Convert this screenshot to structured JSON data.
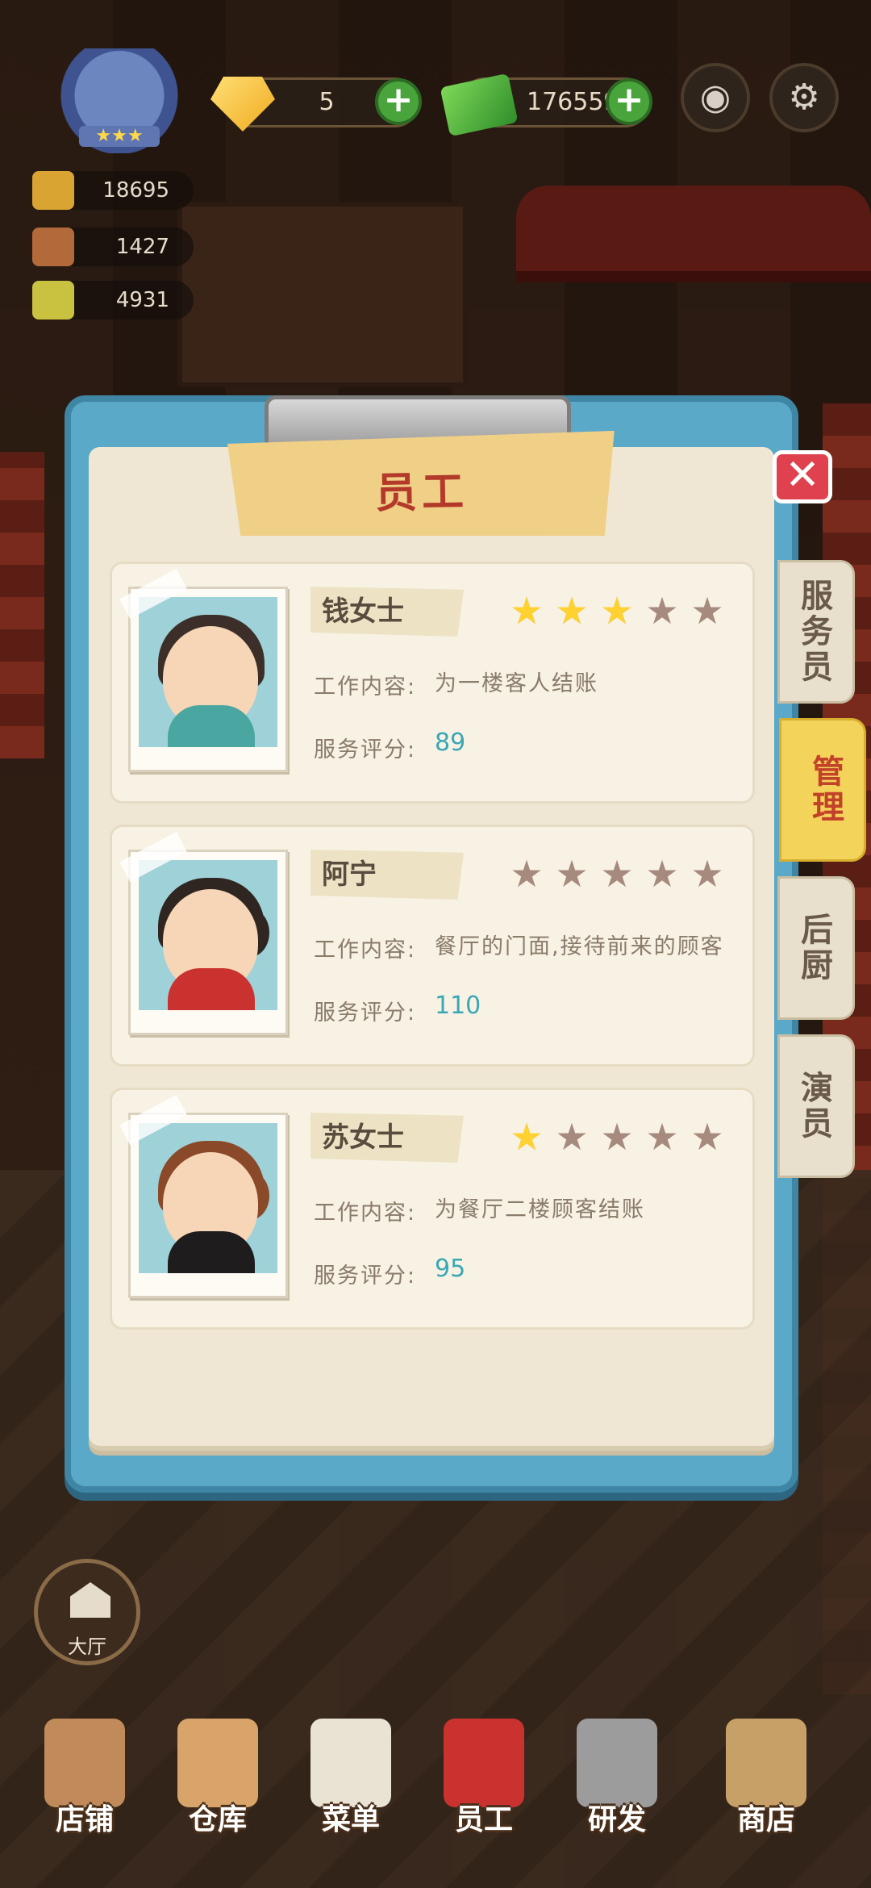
{
  "hud": {
    "gems": "5",
    "cash": "1765590",
    "resources": [
      "18695",
      "1427",
      "4931"
    ],
    "gear_icon": "gear-icon",
    "camera_icon": "camera-icon"
  },
  "dialog": {
    "title": "员工",
    "tabs": [
      "服务员",
      "管理",
      "后厨",
      "演员"
    ],
    "active_tab": "管理",
    "labels": {
      "work": "工作内容:",
      "score": "服务评分:"
    },
    "staff": [
      {
        "name": "钱女士",
        "stars": 3,
        "work": "为一楼客人结账",
        "score": "89"
      },
      {
        "name": "阿宁",
        "stars": 0,
        "work": "餐厅的门面,接待前来的顾客",
        "score": "110"
      },
      {
        "name": "苏女士",
        "stars": 1,
        "work": "为餐厅二楼顾客结账",
        "score": "95"
      }
    ]
  },
  "hall_button": "大厅",
  "nav": [
    "店铺",
    "仓库",
    "菜单",
    "员工",
    "研发",
    "商店"
  ],
  "colors": {
    "accent_red": "#c2412a",
    "score_teal": "#3aa7b6",
    "star_on": "#ffd232",
    "star_off": "#a78a7e"
  }
}
